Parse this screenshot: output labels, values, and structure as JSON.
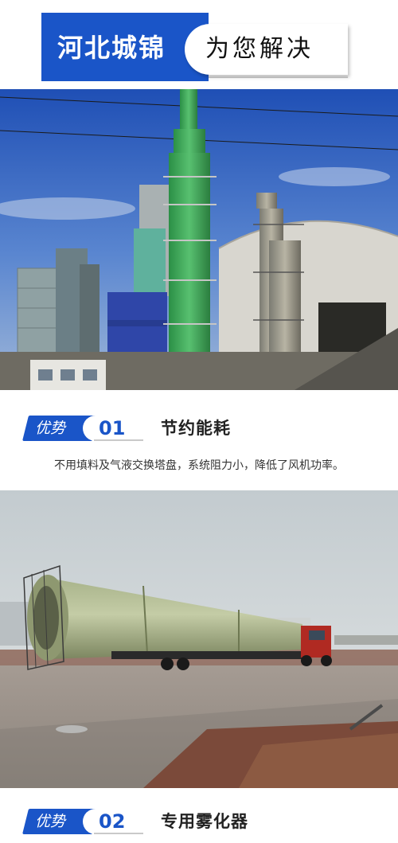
{
  "banner": {
    "left_text": "河北城锦",
    "right_text": "为您解决"
  },
  "sections": [
    {
      "tag": "优势",
      "number": "01",
      "title": "节约能耗",
      "description": "不用填料及气液交换塔盘，系统阻力小，降低了风机功率。"
    },
    {
      "tag": "优势",
      "number": "02",
      "title": "专用雾化器"
    }
  ],
  "colors": {
    "brand_blue": "#1a55c8",
    "tower_green": "#3fae5a"
  }
}
